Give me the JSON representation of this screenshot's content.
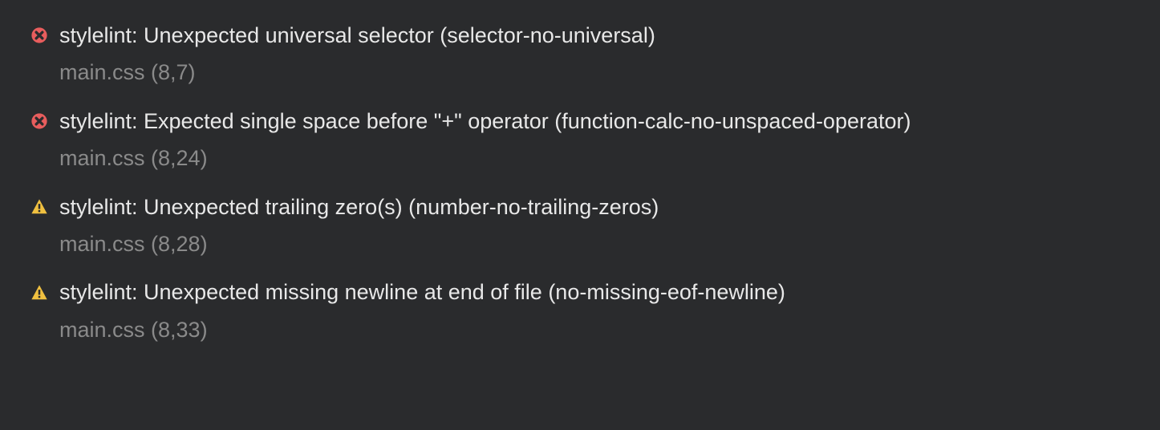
{
  "problems": [
    {
      "severity": "error",
      "message": "stylelint: Unexpected universal selector (selector-no-universal)",
      "location": "main.css (8,7)"
    },
    {
      "severity": "error",
      "message": "stylelint: Expected single space before \"+\" operator (function-calc-no-unspaced-operator)",
      "location": "main.css (8,24)"
    },
    {
      "severity": "warning",
      "message": "stylelint: Unexpected trailing zero(s) (number-no-trailing-zeros)",
      "location": "main.css (8,28)"
    },
    {
      "severity": "warning",
      "message": "stylelint: Unexpected missing newline at end of file (no-missing-eof-newline)",
      "location": "main.css (8,33)"
    }
  ]
}
